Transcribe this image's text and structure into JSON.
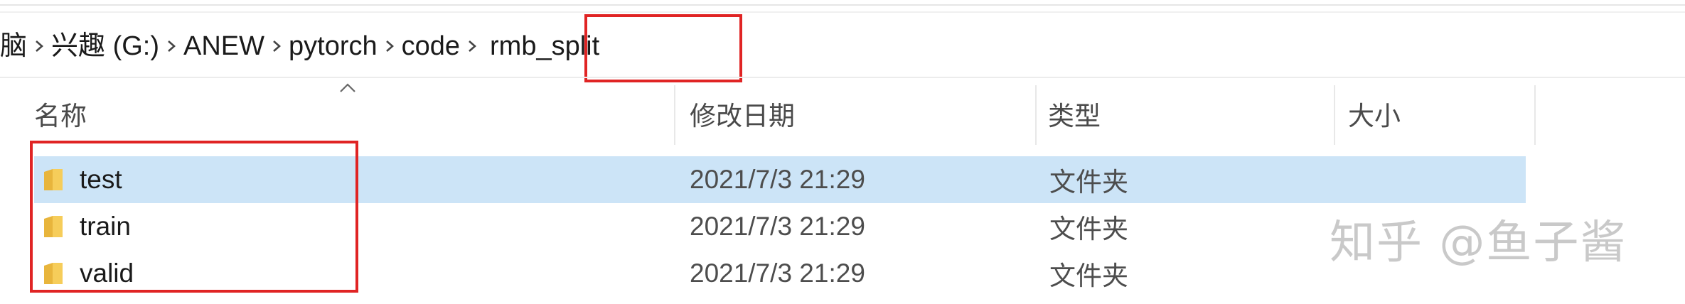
{
  "breadcrumb": {
    "items": [
      "电脑",
      "兴趣 (G:)",
      "ANEW",
      "pytorch",
      "code",
      "rmb_split"
    ]
  },
  "columns": {
    "name": "名称",
    "modified": "修改日期",
    "type": "类型",
    "size": "大小"
  },
  "files": [
    {
      "name": "test",
      "modified": "2021/7/3 21:29",
      "type": "文件夹",
      "size": ""
    },
    {
      "name": "train",
      "modified": "2021/7/3 21:29",
      "type": "文件夹",
      "size": ""
    },
    {
      "name": "valid",
      "modified": "2021/7/3 21:29",
      "type": "文件夹",
      "size": ""
    }
  ],
  "watermark": "知乎 @鱼子酱",
  "colors": {
    "highlight": "#e02424",
    "selection": "#cce4f7",
    "folder": "#f3c44e"
  },
  "icons": [
    "chevron-right-icon",
    "sort-up-icon",
    "folder-icon"
  ]
}
